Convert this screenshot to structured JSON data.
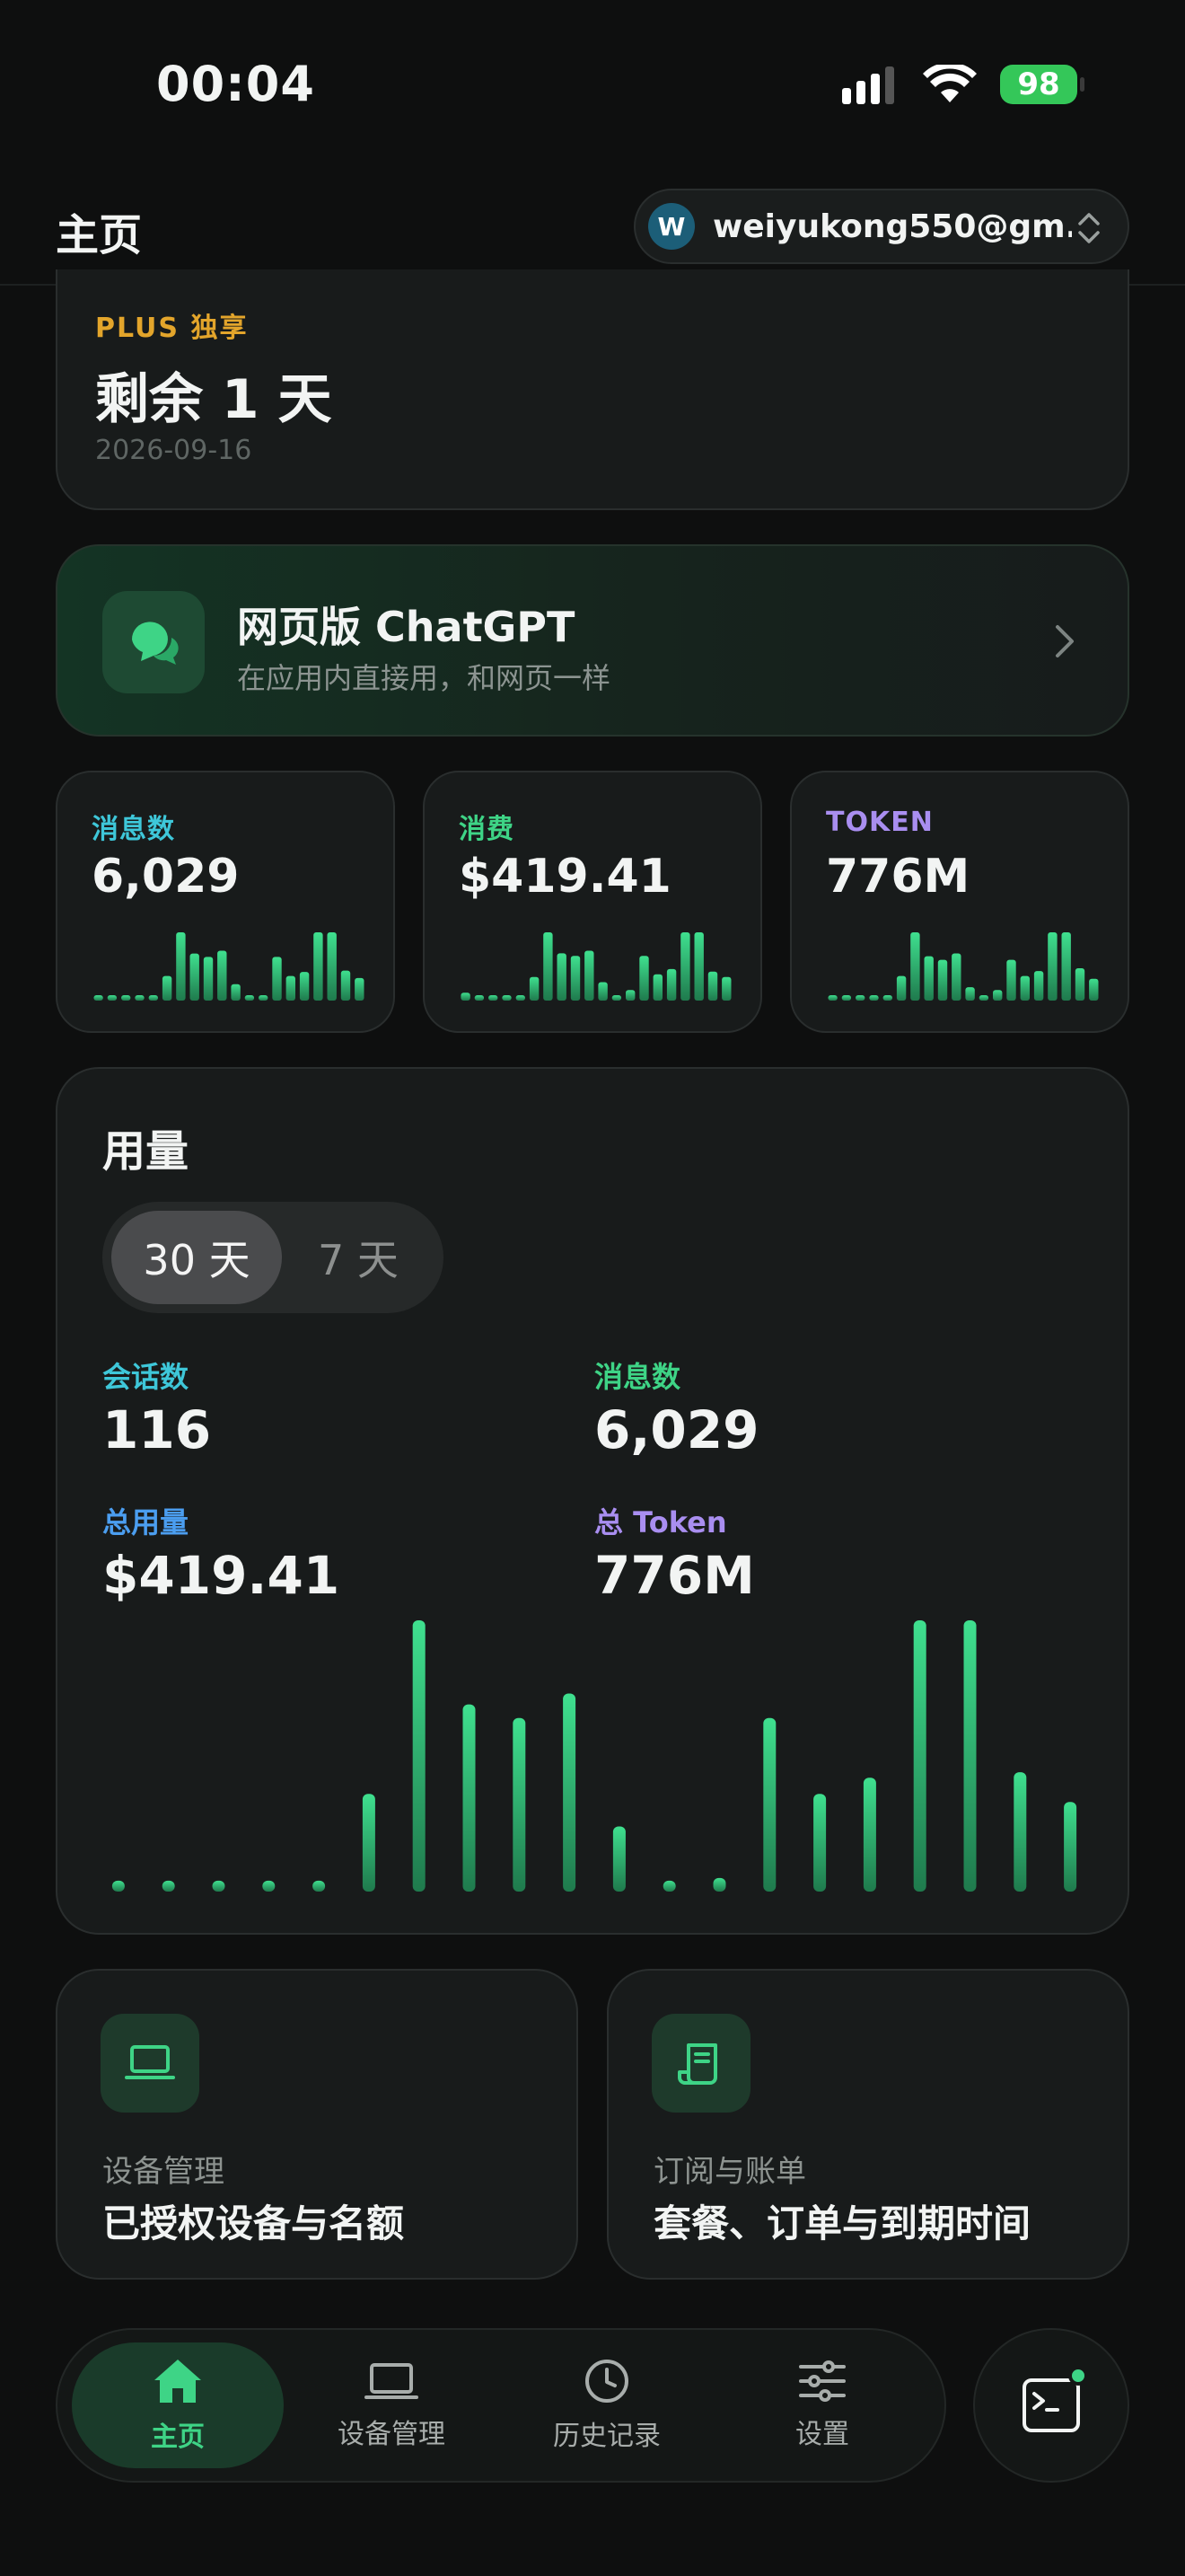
{
  "status": {
    "time": "00:04",
    "battery": "98"
  },
  "header": {
    "title": "主页",
    "avatar_letter": "W",
    "account": "weiyukong550@gm..."
  },
  "plus": {
    "tag": "PLUS 独享",
    "remaining": "剩余 1 天",
    "date": "2026-09-16"
  },
  "web": {
    "title": "网页版 ChatGPT",
    "subtitle": "在应用内直接用，和网页一样"
  },
  "stats": [
    {
      "label": "消息数",
      "value": "6,029",
      "color": "#3ec7d9"
    },
    {
      "label": "消费",
      "value": "$419.41",
      "color": "#3ed486"
    },
    {
      "label": "TOKEN",
      "value": "776M",
      "color": "#a98ef0"
    }
  ],
  "usage": {
    "title": "用量",
    "ranges": [
      "30 天",
      "7 天"
    ],
    "selected_range": "30 天",
    "metrics": [
      {
        "label": "会话数",
        "value": "116",
        "color": "#3ec7d9"
      },
      {
        "label": "消息数",
        "value": "6,029",
        "color": "#3ed486"
      },
      {
        "label": "总用量",
        "value": "$419.41",
        "color": "#4b9ef0"
      },
      {
        "label": "总 Token",
        "value": "776M",
        "color": "#a98ef0"
      }
    ]
  },
  "chart_data": [
    {
      "type": "bar",
      "values": [
        4,
        4,
        4,
        4,
        4,
        36,
        100,
        69,
        64,
        73,
        24,
        4,
        5,
        64,
        36,
        42,
        100,
        100,
        44,
        33
      ]
    },
    {
      "type": "bar",
      "values": [
        3,
        2,
        2,
        2,
        2,
        9,
        26,
        18,
        17,
        19,
        7,
        2,
        4,
        17,
        10,
        12,
        26,
        26,
        11,
        9
      ]
    },
    {
      "type": "bar",
      "values": [
        1.2,
        0.8,
        0.8,
        0.8,
        0.8,
        7,
        19.4,
        12.6,
        11.6,
        13.4,
        3.8,
        0.8,
        3,
        11.6,
        7,
        8.4,
        19.4,
        19.4,
        9.2,
        6.2
      ]
    },
    {
      "type": "bar",
      "values": [
        4,
        4,
        4,
        4,
        4,
        36,
        100,
        69,
        64,
        73,
        24,
        4,
        5,
        64,
        36,
        42,
        100,
        100,
        44,
        33
      ]
    }
  ],
  "features": [
    {
      "label": "设备管理",
      "title": "已授权设备与名额"
    },
    {
      "label": "订阅与账单",
      "title": "套餐、订单与到期时间"
    }
  ],
  "tabs": [
    {
      "label": "主页",
      "icon": "home-icon"
    },
    {
      "label": "设备管理",
      "icon": "laptop-icon"
    },
    {
      "label": "历史记录",
      "icon": "clock-icon"
    },
    {
      "label": "设置",
      "icon": "sliders-icon"
    }
  ],
  "colors": {
    "accent": "#3ed486",
    "plus": "#e3a52b"
  }
}
